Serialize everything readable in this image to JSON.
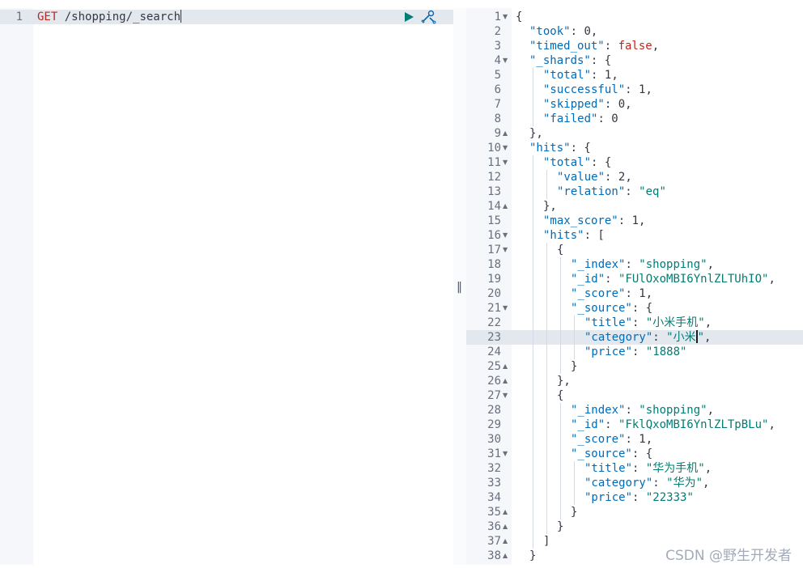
{
  "request_editor": {
    "line_number": "1",
    "method": "GET",
    "path": " /shopping/_search",
    "run_icon": "play-icon",
    "settings_icon": "wrench-icon"
  },
  "resizer": {
    "grip_label": "‖"
  },
  "response": {
    "active_line": 23,
    "lines": [
      {
        "n": "1",
        "fold": "▼",
        "indent": 0,
        "tokens": [
          [
            "p",
            "{"
          ]
        ]
      },
      {
        "n": "2",
        "fold": "",
        "indent": 1,
        "tokens": [
          [
            "k",
            "\"took\""
          ],
          [
            "p",
            ": "
          ],
          [
            "n",
            "0"
          ],
          [
            "p",
            ","
          ]
        ]
      },
      {
        "n": "3",
        "fold": "",
        "indent": 1,
        "tokens": [
          [
            "k",
            "\"timed_out\""
          ],
          [
            "p",
            ": "
          ],
          [
            "b",
            "false"
          ],
          [
            "p",
            ","
          ]
        ]
      },
      {
        "n": "4",
        "fold": "▼",
        "indent": 1,
        "tokens": [
          [
            "k",
            "\"_shards\""
          ],
          [
            "p",
            ": {"
          ]
        ]
      },
      {
        "n": "5",
        "fold": "",
        "indent": 2,
        "tokens": [
          [
            "k",
            "\"total\""
          ],
          [
            "p",
            ": "
          ],
          [
            "n",
            "1"
          ],
          [
            "p",
            ","
          ]
        ]
      },
      {
        "n": "6",
        "fold": "",
        "indent": 2,
        "tokens": [
          [
            "k",
            "\"successful\""
          ],
          [
            "p",
            ": "
          ],
          [
            "n",
            "1"
          ],
          [
            "p",
            ","
          ]
        ]
      },
      {
        "n": "7",
        "fold": "",
        "indent": 2,
        "tokens": [
          [
            "k",
            "\"skipped\""
          ],
          [
            "p",
            ": "
          ],
          [
            "n",
            "0"
          ],
          [
            "p",
            ","
          ]
        ]
      },
      {
        "n": "8",
        "fold": "",
        "indent": 2,
        "tokens": [
          [
            "k",
            "\"failed\""
          ],
          [
            "p",
            ": "
          ],
          [
            "n",
            "0"
          ]
        ]
      },
      {
        "n": "9",
        "fold": "▲",
        "indent": 1,
        "tokens": [
          [
            "p",
            "},"
          ]
        ]
      },
      {
        "n": "10",
        "fold": "▼",
        "indent": 1,
        "tokens": [
          [
            "k",
            "\"hits\""
          ],
          [
            "p",
            ": {"
          ]
        ]
      },
      {
        "n": "11",
        "fold": "▼",
        "indent": 2,
        "tokens": [
          [
            "k",
            "\"total\""
          ],
          [
            "p",
            ": {"
          ]
        ]
      },
      {
        "n": "12",
        "fold": "",
        "indent": 3,
        "tokens": [
          [
            "k",
            "\"value\""
          ],
          [
            "p",
            ": "
          ],
          [
            "n",
            "2"
          ],
          [
            "p",
            ","
          ]
        ]
      },
      {
        "n": "13",
        "fold": "",
        "indent": 3,
        "tokens": [
          [
            "k",
            "\"relation\""
          ],
          [
            "p",
            ": "
          ],
          [
            "s",
            "\"eq\""
          ]
        ]
      },
      {
        "n": "14",
        "fold": "▲",
        "indent": 2,
        "tokens": [
          [
            "p",
            "},"
          ]
        ]
      },
      {
        "n": "15",
        "fold": "",
        "indent": 2,
        "tokens": [
          [
            "k",
            "\"max_score\""
          ],
          [
            "p",
            ": "
          ],
          [
            "n",
            "1"
          ],
          [
            "p",
            ","
          ]
        ]
      },
      {
        "n": "16",
        "fold": "▼",
        "indent": 2,
        "tokens": [
          [
            "k",
            "\"hits\""
          ],
          [
            "p",
            ": ["
          ]
        ]
      },
      {
        "n": "17",
        "fold": "▼",
        "indent": 3,
        "tokens": [
          [
            "p",
            "{"
          ]
        ]
      },
      {
        "n": "18",
        "fold": "",
        "indent": 4,
        "tokens": [
          [
            "k",
            "\"_index\""
          ],
          [
            "p",
            ": "
          ],
          [
            "s",
            "\"shopping\""
          ],
          [
            "p",
            ","
          ]
        ]
      },
      {
        "n": "19",
        "fold": "",
        "indent": 4,
        "tokens": [
          [
            "k",
            "\"_id\""
          ],
          [
            "p",
            ": "
          ],
          [
            "s",
            "\"FUlOxoMBI6YnlZLTUhIO\""
          ],
          [
            "p",
            ","
          ]
        ]
      },
      {
        "n": "20",
        "fold": "",
        "indent": 4,
        "tokens": [
          [
            "k",
            "\"_score\""
          ],
          [
            "p",
            ": "
          ],
          [
            "n",
            "1"
          ],
          [
            "p",
            ","
          ]
        ]
      },
      {
        "n": "21",
        "fold": "▼",
        "indent": 4,
        "tokens": [
          [
            "k",
            "\"_source\""
          ],
          [
            "p",
            ": {"
          ]
        ]
      },
      {
        "n": "22",
        "fold": "",
        "indent": 5,
        "tokens": [
          [
            "k",
            "\"title\""
          ],
          [
            "p",
            ": "
          ],
          [
            "s",
            "\"小米手机\""
          ],
          [
            "p",
            ","
          ]
        ]
      },
      {
        "n": "23",
        "fold": "",
        "indent": 5,
        "tokens": [
          [
            "k",
            "\"category\""
          ],
          [
            "p",
            ": "
          ],
          [
            "s",
            "\"小米"
          ],
          [
            "cursor",
            ""
          ],
          [
            "s",
            "\""
          ],
          [
            "p",
            ","
          ]
        ]
      },
      {
        "n": "24",
        "fold": "",
        "indent": 5,
        "tokens": [
          [
            "k",
            "\"price\""
          ],
          [
            "p",
            ": "
          ],
          [
            "s",
            "\"1888\""
          ]
        ]
      },
      {
        "n": "25",
        "fold": "▲",
        "indent": 4,
        "tokens": [
          [
            "p",
            "}"
          ]
        ]
      },
      {
        "n": "26",
        "fold": "▲",
        "indent": 3,
        "tokens": [
          [
            "p",
            "},"
          ]
        ]
      },
      {
        "n": "27",
        "fold": "▼",
        "indent": 3,
        "tokens": [
          [
            "p",
            "{"
          ]
        ]
      },
      {
        "n": "28",
        "fold": "",
        "indent": 4,
        "tokens": [
          [
            "k",
            "\"_index\""
          ],
          [
            "p",
            ": "
          ],
          [
            "s",
            "\"shopping\""
          ],
          [
            "p",
            ","
          ]
        ]
      },
      {
        "n": "29",
        "fold": "",
        "indent": 4,
        "tokens": [
          [
            "k",
            "\"_id\""
          ],
          [
            "p",
            ": "
          ],
          [
            "s",
            "\"FklQxoMBI6YnlZLTpBLu\""
          ],
          [
            "p",
            ","
          ]
        ]
      },
      {
        "n": "30",
        "fold": "",
        "indent": 4,
        "tokens": [
          [
            "k",
            "\"_score\""
          ],
          [
            "p",
            ": "
          ],
          [
            "n",
            "1"
          ],
          [
            "p",
            ","
          ]
        ]
      },
      {
        "n": "31",
        "fold": "▼",
        "indent": 4,
        "tokens": [
          [
            "k",
            "\"_source\""
          ],
          [
            "p",
            ": {"
          ]
        ]
      },
      {
        "n": "32",
        "fold": "",
        "indent": 5,
        "tokens": [
          [
            "k",
            "\"title\""
          ],
          [
            "p",
            ": "
          ],
          [
            "s",
            "\"华为手机\""
          ],
          [
            "p",
            ","
          ]
        ]
      },
      {
        "n": "33",
        "fold": "",
        "indent": 5,
        "tokens": [
          [
            "k",
            "\"category\""
          ],
          [
            "p",
            ": "
          ],
          [
            "s",
            "\"华为\""
          ],
          [
            "p",
            ","
          ]
        ]
      },
      {
        "n": "34",
        "fold": "",
        "indent": 5,
        "tokens": [
          [
            "k",
            "\"price\""
          ],
          [
            "p",
            ": "
          ],
          [
            "s",
            "\"22333\""
          ]
        ]
      },
      {
        "n": "35",
        "fold": "▲",
        "indent": 4,
        "tokens": [
          [
            "p",
            "}"
          ]
        ]
      },
      {
        "n": "36",
        "fold": "▲",
        "indent": 3,
        "tokens": [
          [
            "p",
            "}"
          ]
        ]
      },
      {
        "n": "37",
        "fold": "▲",
        "indent": 2,
        "tokens": [
          [
            "p",
            "]"
          ]
        ]
      },
      {
        "n": "38",
        "fold": "▲",
        "indent": 1,
        "tokens": [
          [
            "p",
            "}"
          ]
        ]
      }
    ]
  },
  "watermark": "CSDN @野生开发者"
}
